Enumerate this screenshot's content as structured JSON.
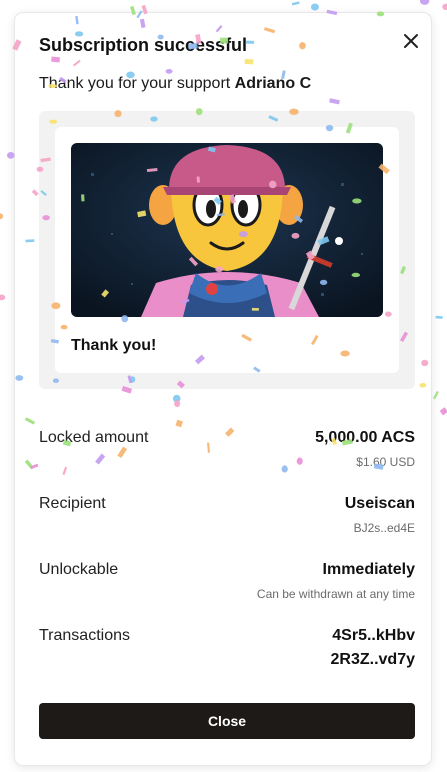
{
  "dialog": {
    "title": "Subscription successful",
    "thank_prefix": "Thank you for your support",
    "supporter": "Adriano C"
  },
  "card": {
    "caption": "Thank you!",
    "image": "cartoon-character-in-pink-cap-artwork"
  },
  "details": {
    "locked": {
      "label": "Locked amount",
      "value": "5,000.00 ACS",
      "sub": "$1.60 USD"
    },
    "recipient": {
      "label": "Recipient",
      "value": "Useiscan",
      "sub": "BJ2s..ed4E"
    },
    "unlockable": {
      "label": "Unlockable",
      "value": "Immediately",
      "sub": "Can be withdrawn at any time"
    },
    "transactions": {
      "label": "Transactions",
      "values": [
        "4Sr5..kHbv",
        "2R3Z..vd7y"
      ]
    }
  },
  "actions": {
    "close_label": "Close"
  },
  "icons": {
    "close": "close-icon"
  },
  "colors": {
    "button_bg": "#1e1a18",
    "card_bg": "#f2f2f2",
    "confetti": [
      "#f5a3c7",
      "#7ec8f0",
      "#c39bf0",
      "#f7e36b",
      "#9be07b",
      "#f6b26b",
      "#e88fd6",
      "#8fb8f0"
    ]
  }
}
